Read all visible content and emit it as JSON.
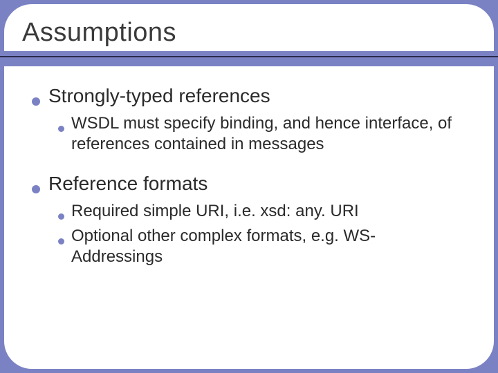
{
  "title": "Assumptions",
  "items": [
    {
      "label": "Strongly-typed references",
      "children": [
        {
          "label": "WSDL must specify binding, and hence interface, of references contained in messages"
        }
      ]
    },
    {
      "label": "Reference formats",
      "children": [
        {
          "label": "Required simple URI, i.e. xsd: any. URI"
        },
        {
          "label": "Optional other complex formats, e.g. WS-Addressings"
        }
      ]
    }
  ]
}
